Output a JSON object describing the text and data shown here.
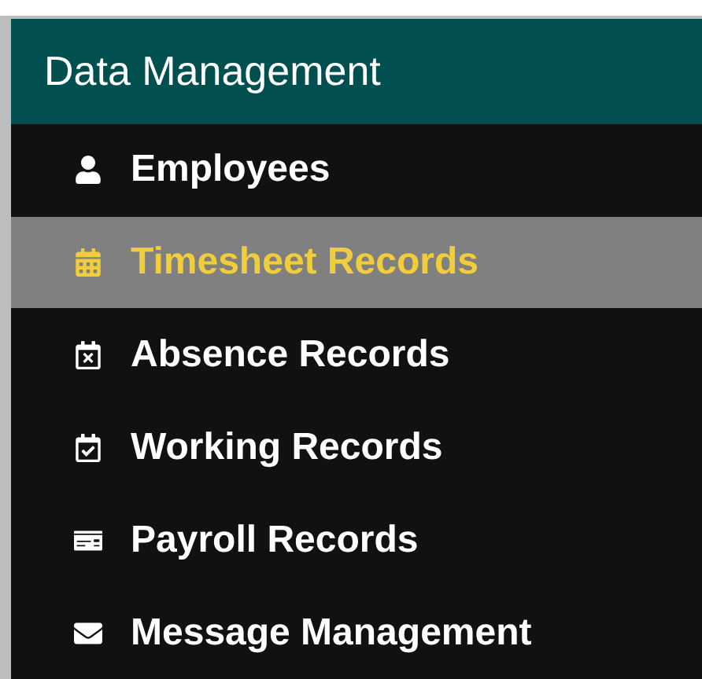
{
  "panel": {
    "title": "Data Management"
  },
  "items": [
    {
      "label": "Employees",
      "selected": false
    },
    {
      "label": "Timesheet Records",
      "selected": true
    },
    {
      "label": "Absence Records",
      "selected": false
    },
    {
      "label": "Working Records",
      "selected": false
    },
    {
      "label": "Payroll Records",
      "selected": false
    },
    {
      "label": "Message Management",
      "selected": false
    }
  ]
}
